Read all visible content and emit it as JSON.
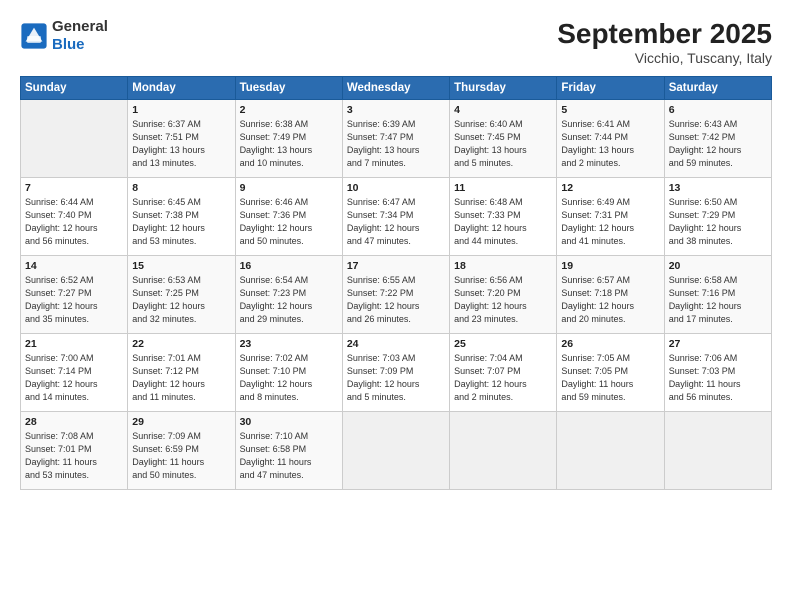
{
  "logo": {
    "general": "General",
    "blue": "Blue"
  },
  "title": "September 2025",
  "location": "Vicchio, Tuscany, Italy",
  "days_header": [
    "Sunday",
    "Monday",
    "Tuesday",
    "Wednesday",
    "Thursday",
    "Friday",
    "Saturday"
  ],
  "weeks": [
    [
      {
        "day": "",
        "content": ""
      },
      {
        "day": "1",
        "content": "Sunrise: 6:37 AM\nSunset: 7:51 PM\nDaylight: 13 hours\nand 13 minutes."
      },
      {
        "day": "2",
        "content": "Sunrise: 6:38 AM\nSunset: 7:49 PM\nDaylight: 13 hours\nand 10 minutes."
      },
      {
        "day": "3",
        "content": "Sunrise: 6:39 AM\nSunset: 7:47 PM\nDaylight: 13 hours\nand 7 minutes."
      },
      {
        "day": "4",
        "content": "Sunrise: 6:40 AM\nSunset: 7:45 PM\nDaylight: 13 hours\nand 5 minutes."
      },
      {
        "day": "5",
        "content": "Sunrise: 6:41 AM\nSunset: 7:44 PM\nDaylight: 13 hours\nand 2 minutes."
      },
      {
        "day": "6",
        "content": "Sunrise: 6:43 AM\nSunset: 7:42 PM\nDaylight: 12 hours\nand 59 minutes."
      }
    ],
    [
      {
        "day": "7",
        "content": "Sunrise: 6:44 AM\nSunset: 7:40 PM\nDaylight: 12 hours\nand 56 minutes."
      },
      {
        "day": "8",
        "content": "Sunrise: 6:45 AM\nSunset: 7:38 PM\nDaylight: 12 hours\nand 53 minutes."
      },
      {
        "day": "9",
        "content": "Sunrise: 6:46 AM\nSunset: 7:36 PM\nDaylight: 12 hours\nand 50 minutes."
      },
      {
        "day": "10",
        "content": "Sunrise: 6:47 AM\nSunset: 7:34 PM\nDaylight: 12 hours\nand 47 minutes."
      },
      {
        "day": "11",
        "content": "Sunrise: 6:48 AM\nSunset: 7:33 PM\nDaylight: 12 hours\nand 44 minutes."
      },
      {
        "day": "12",
        "content": "Sunrise: 6:49 AM\nSunset: 7:31 PM\nDaylight: 12 hours\nand 41 minutes."
      },
      {
        "day": "13",
        "content": "Sunrise: 6:50 AM\nSunset: 7:29 PM\nDaylight: 12 hours\nand 38 minutes."
      }
    ],
    [
      {
        "day": "14",
        "content": "Sunrise: 6:52 AM\nSunset: 7:27 PM\nDaylight: 12 hours\nand 35 minutes."
      },
      {
        "day": "15",
        "content": "Sunrise: 6:53 AM\nSunset: 7:25 PM\nDaylight: 12 hours\nand 32 minutes."
      },
      {
        "day": "16",
        "content": "Sunrise: 6:54 AM\nSunset: 7:23 PM\nDaylight: 12 hours\nand 29 minutes."
      },
      {
        "day": "17",
        "content": "Sunrise: 6:55 AM\nSunset: 7:22 PM\nDaylight: 12 hours\nand 26 minutes."
      },
      {
        "day": "18",
        "content": "Sunrise: 6:56 AM\nSunset: 7:20 PM\nDaylight: 12 hours\nand 23 minutes."
      },
      {
        "day": "19",
        "content": "Sunrise: 6:57 AM\nSunset: 7:18 PM\nDaylight: 12 hours\nand 20 minutes."
      },
      {
        "day": "20",
        "content": "Sunrise: 6:58 AM\nSunset: 7:16 PM\nDaylight: 12 hours\nand 17 minutes."
      }
    ],
    [
      {
        "day": "21",
        "content": "Sunrise: 7:00 AM\nSunset: 7:14 PM\nDaylight: 12 hours\nand 14 minutes."
      },
      {
        "day": "22",
        "content": "Sunrise: 7:01 AM\nSunset: 7:12 PM\nDaylight: 12 hours\nand 11 minutes."
      },
      {
        "day": "23",
        "content": "Sunrise: 7:02 AM\nSunset: 7:10 PM\nDaylight: 12 hours\nand 8 minutes."
      },
      {
        "day": "24",
        "content": "Sunrise: 7:03 AM\nSunset: 7:09 PM\nDaylight: 12 hours\nand 5 minutes."
      },
      {
        "day": "25",
        "content": "Sunrise: 7:04 AM\nSunset: 7:07 PM\nDaylight: 12 hours\nand 2 minutes."
      },
      {
        "day": "26",
        "content": "Sunrise: 7:05 AM\nSunset: 7:05 PM\nDaylight: 11 hours\nand 59 minutes."
      },
      {
        "day": "27",
        "content": "Sunrise: 7:06 AM\nSunset: 7:03 PM\nDaylight: 11 hours\nand 56 minutes."
      }
    ],
    [
      {
        "day": "28",
        "content": "Sunrise: 7:08 AM\nSunset: 7:01 PM\nDaylight: 11 hours\nand 53 minutes."
      },
      {
        "day": "29",
        "content": "Sunrise: 7:09 AM\nSunset: 6:59 PM\nDaylight: 11 hours\nand 50 minutes."
      },
      {
        "day": "30",
        "content": "Sunrise: 7:10 AM\nSunset: 6:58 PM\nDaylight: 11 hours\nand 47 minutes."
      },
      {
        "day": "",
        "content": ""
      },
      {
        "day": "",
        "content": ""
      },
      {
        "day": "",
        "content": ""
      },
      {
        "day": "",
        "content": ""
      }
    ]
  ]
}
